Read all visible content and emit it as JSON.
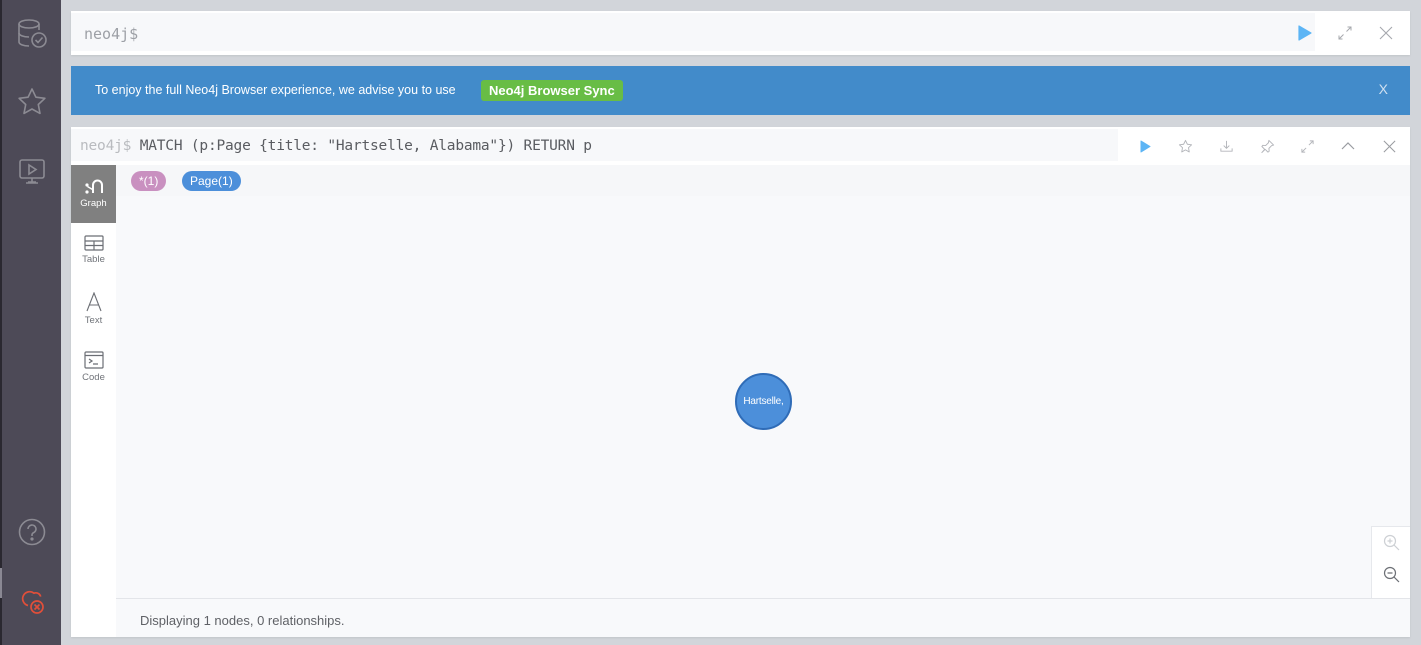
{
  "nav": {
    "items": [
      {
        "name": "database",
        "icon": "database-check-icon"
      },
      {
        "name": "favorites",
        "icon": "star-icon"
      },
      {
        "name": "guides",
        "icon": "monitor-play-icon"
      },
      {
        "name": "help",
        "icon": "help-icon"
      },
      {
        "name": "sync",
        "icon": "cloud-disconnected-icon"
      }
    ],
    "colors": {
      "icon": "#8c8b93",
      "alert": "#e04f3a"
    }
  },
  "editor": {
    "prompt": "neo4j$",
    "buttons": [
      "run",
      "fullscreen",
      "close"
    ]
  },
  "banner": {
    "message": "To enjoy the full Neo4j Browser experience, we advise you to use",
    "button_label": "Neo4j Browser Sync",
    "close_label": "X",
    "color": "#428bca",
    "button_color": "#68bd45"
  },
  "result": {
    "prompt": "neo4j$",
    "query": " MATCH (p:Page {title: \"Hartselle, Alabama\"}) RETURN p",
    "toolbar": [
      "run",
      "favorite",
      "download",
      "pin",
      "fullscreen",
      "collapse",
      "close"
    ],
    "view_tabs": [
      {
        "label": "Graph",
        "active": true
      },
      {
        "label": "Table",
        "active": false
      },
      {
        "label": "Text",
        "active": false
      },
      {
        "label": "Code",
        "active": false
      }
    ],
    "labels": [
      {
        "text": "*(1)",
        "color": "#c990c0"
      },
      {
        "text": "Page(1)",
        "color": "#4c8fda"
      }
    ],
    "node": {
      "caption": "Hartselle,",
      "color": "#4c8fda"
    },
    "status": "Displaying 1 nodes, 0 relationships."
  }
}
